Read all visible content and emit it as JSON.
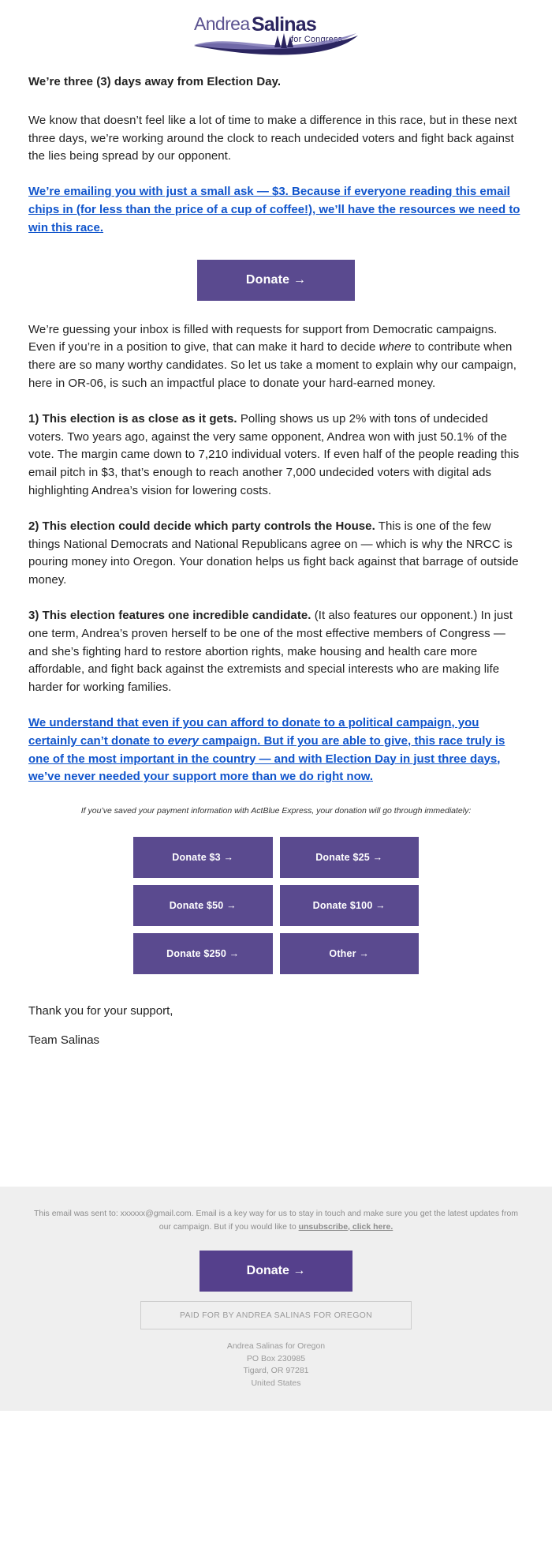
{
  "brand": {
    "logo_first_name": "Andrea",
    "logo_last_name": "Salinas",
    "logo_tagline": "for Congress",
    "accent_purple": "#5a4a8f",
    "accent_navy": "#2b2560",
    "link_blue": "#1155cc"
  },
  "body": {
    "lead": "We’re three (3) days away from Election Day.",
    "p1": "We know that doesn’t feel like a lot of time to make a difference in this race, but in these next three days, we’re working around the clock to reach undecided voters and fight back against the lies being spread by our opponent.",
    "link1": "We’re emailing you with just a small ask — $3. Because if everyone reading this email chips in (for less than the price of a cup of coffee!), we’ll have the resources we need to win this race.",
    "p2_a": "We’re guessing your inbox is filled with requests for support from Democratic campaigns. Even if you’re in a position to give, that can make it hard to decide ",
    "p2_em": "where",
    "p2_b": " to contribute when there are so many worthy candidates. So let us take a moment to explain why our campaign, here in OR-06, is such an impactful place to donate your hard-earned money.",
    "point1_bold": "1) This election is as close as it gets.",
    "point1_rest": " Polling shows us up 2% with tons of undecided voters. Two years ago, against the very same opponent, Andrea won with just 50.1% of the vote. The margin came down to 7,210 individual voters. If even half of the people reading this email pitch in $3, that’s enough to reach another 7,000 undecided voters with digital ads highlighting Andrea’s vision for lowering costs.",
    "point2_bold": "2) This election could decide which party controls the House.",
    "point2_rest": " This is one of the few things National Democrats and National Republicans agree on — which is why the NRCC is pouring money into Oregon. Your donation helps us fight back against that barrage of outside money.",
    "point3_bold": "3) This election features one incredible candidate.",
    "point3_a": " (It also features our opponent.) In just one term, Andrea’s proven herself to be one of the most effective members of Congress — and she’s fighting hard to restore abortion rights, make housing and health care more affordable, and fight back against the extremists and special interests who are making life harder for working families.",
    "link2_a": "We understand that even if you can afford to donate to a political campaign, you certainly can’t donate to ",
    "link2_em": "every",
    "link2_b": " campaign. But if you are able to give, this race truly is one of the most important in the country — and with Election Day in just three days, we’ve never needed your support more than we do right now.",
    "signoff_line1": "Thank you for your support,",
    "signoff_line2": "Team Salinas"
  },
  "cta": {
    "main_donate_label": "Donate →",
    "actblue_note": "If you’ve saved your payment information with ActBlue Express, your donation will go through immediately:",
    "amount_buttons": [
      "Donate $3 →",
      "Donate $25 →",
      "Donate $50 →",
      "Donate $100 →",
      "Donate $250 →",
      "Other →"
    ]
  },
  "footer": {
    "disclaimer_a": "This email was sent to: xxxxxx@gmail.com. Email is a key way for us to stay in touch and make sure you get the latest updates from our campaign. But if you would like to ",
    "disclaimer_link": "unsubscribe, click here.",
    "donate_label": "Donate →",
    "paid_for": "PAID FOR BY ANDREA SALINAS FOR OREGON",
    "address_line1": "Andrea Salinas for Oregon",
    "address_line2": "PO Box 230985",
    "address_line3": "Tigard, OR 97281",
    "address_line4": "United States"
  }
}
